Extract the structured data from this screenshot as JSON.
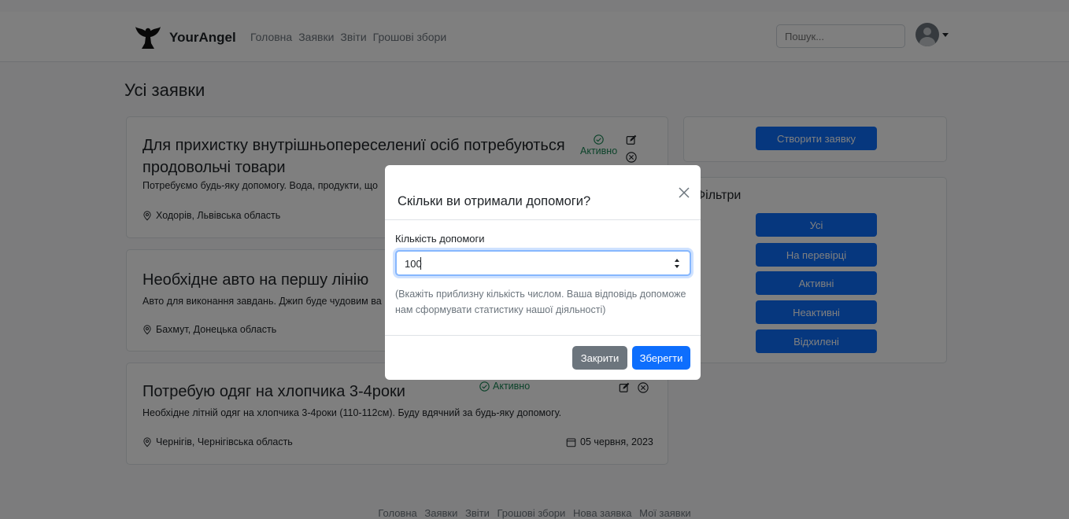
{
  "navbar": {
    "brand": "YourAngel",
    "links": [
      "Головна",
      "Заявки",
      "Звіти",
      "Грошові збори"
    ],
    "search_placeholder": "Пошук..."
  },
  "page_title": "Усі заявки",
  "cards": [
    {
      "title": "Для прихистку внутрішньопереселениї осіб потребуються продовольчі товари",
      "description": "Потребуємо будь-яку допомогу. Вода, продукти, що",
      "location": "Ходорів, Львівська область",
      "status": "Активно"
    },
    {
      "title": "Необхідне авто на першу лінію",
      "description": "Авто для виконання завдань. Джип буде чудовим ва",
      "location": "Бахмут, Донецька область"
    },
    {
      "title": "Потребую одяг на хлопчика 3-4роки",
      "description": "Необхідне літній одяг на хлопчика 3-4роки (110-112см). Буду вдячний за будь-яку допомогу.",
      "location": "Чернігів, Чернігівська область",
      "status": "Активно",
      "date": "05 червня, 2023"
    }
  ],
  "sidebar": {
    "create_button": "Створити заявку",
    "filters_title": "Фільтри",
    "filters": [
      "Усі",
      "На перевірці",
      "Активні",
      "Неактивні",
      "Відхилені"
    ]
  },
  "footer_links": [
    "Головна",
    "Заявки",
    "Звіти",
    "Грошові збори",
    "Нова заявка",
    "Мої заявки"
  ],
  "modal": {
    "title": "Скільки ви отримали допомоги?",
    "field_label": "Кількість допомоги",
    "field_value": "100",
    "hint": "(Вкажіть приблизну кількість числом. Ваша відповідь допоможе нам сформувати статистику нашої діяльності)",
    "close_button": "Закрити",
    "save_button": "Зберегти"
  },
  "colors": {
    "primary": "#0d6efd",
    "secondary": "#6c757d",
    "success": "#198754"
  }
}
